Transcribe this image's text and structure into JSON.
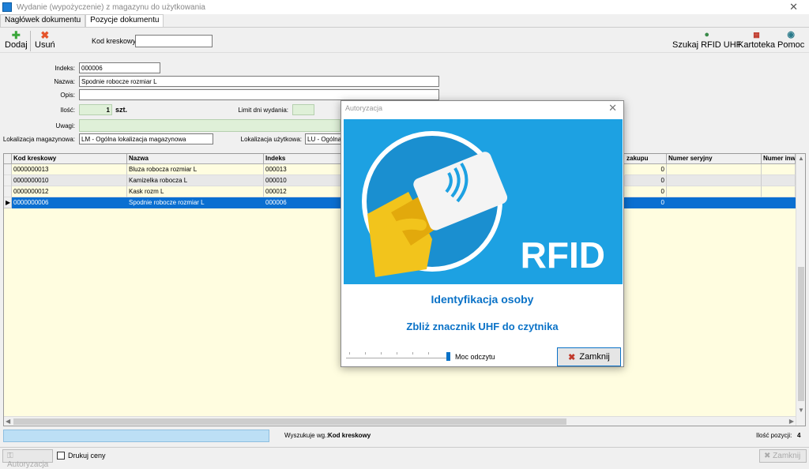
{
  "window": {
    "title": "Wydanie (wypożyczenie) z magazynu do użytkowania",
    "close_glyph": "✕"
  },
  "tabs": [
    {
      "label": "Nagłówek dokumentu"
    },
    {
      "label": "Pozycje dokumentu"
    }
  ],
  "toolbar": {
    "add_label": "Dodaj",
    "delete_label": "Usuń",
    "barcode_label": "Kod kreskowy",
    "barcode_value": "",
    "rfid_label": "Szukaj RFID UHF",
    "card_label": "Kartoteka",
    "help_label": "Pomoc"
  },
  "form": {
    "index_label": "Indeks:",
    "index_value": "000006",
    "name_label": "Nazwa:",
    "name_value": "Spodnie robocze rozmiar L",
    "desc_label": "Opis:",
    "desc_value": "",
    "qty_label": "Ilość:",
    "qty_value": "1",
    "qty_unit": "szt.",
    "limit_label": "Limit dni wydania:",
    "limit_value": "",
    "notes_label": "Uwagi:",
    "notes_value": "",
    "warehouse_loc_label": "Lokalizacja magazynowa:",
    "warehouse_loc_value": "LM - Ogólna lokalizacja magazynowa",
    "usage_loc_label": "Lokalizacja użytkowa:",
    "usage_loc_value": "LU - Ogólna"
  },
  "grid": {
    "columns": [
      "Kod kreskowy",
      "Nazwa",
      "Indeks",
      "zakupu",
      "Numer seryjny",
      "Numer inw"
    ],
    "rows": [
      {
        "barcode": "0000000013",
        "name": "Bluza robocza rozmiar L",
        "index": "000013",
        "price": "0",
        "serial": "",
        "inv": ""
      },
      {
        "barcode": "0000000010",
        "name": "Kamizelka robocza L",
        "index": "000010",
        "price": "0",
        "serial": "",
        "inv": ""
      },
      {
        "barcode": "0000000012",
        "name": "Kask rozm L",
        "index": "000012",
        "price": "0",
        "serial": "",
        "inv": ""
      },
      {
        "barcode": "0000000006",
        "name": "Spodnie robocze rozmiar L",
        "index": "000006",
        "price": "0",
        "serial": "",
        "inv": ""
      }
    ],
    "selected_row": 3
  },
  "status": {
    "search_label": "Wyszukuje wg.:",
    "search_value": "Kod kreskowy",
    "count_label": "Ilość pozycji:",
    "count_value": "4"
  },
  "bottom": {
    "auth_label": "Autoryzacja",
    "print_prices_label": "Drukuj ceny",
    "close_label": "Zamknij"
  },
  "dialog": {
    "title": "Autoryzacja",
    "close_glyph": "✕",
    "rfid_text": "RFID",
    "heading": "Identyfikacja osoby",
    "subheading": "Zbliż znacznik UHF do czytnika",
    "power_label": "Moc odczytu",
    "power_level": 1.0,
    "close_label": "Zamknij"
  },
  "colors": {
    "accent": "#0a6fd1",
    "rfid_bg": "#1da1e2",
    "grid_bg": "#fffde0",
    "status_bar": "#bcdff5"
  }
}
